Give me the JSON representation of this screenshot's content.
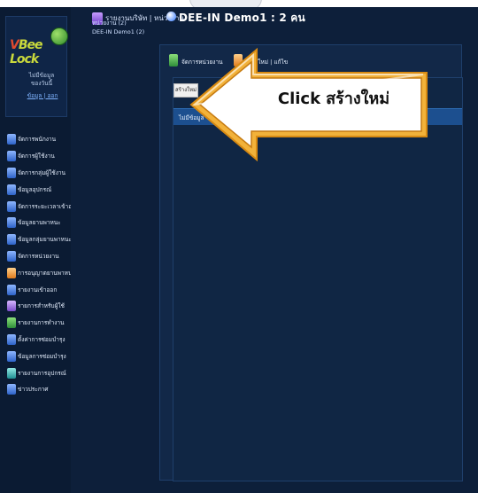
{
  "header": {
    "breadcrumb": "รายงานบริษัท | หน่วยงาน",
    "title": "DEE-IN Demo1 : 2 คน",
    "sub_label": "หน่วยงาน (2)",
    "group_label": "DEE-IN Demo1 (2)"
  },
  "sidebar": {
    "logo_prefix": "V",
    "logo_text": "Bee Lock",
    "user_info_line1": "ไม่มีข้อมูล",
    "user_info_line2": "ของวันนี้",
    "user_links": "ข้อมูล | ออก",
    "items": [
      {
        "label": "จัดการพนักงาน",
        "color": "blue"
      },
      {
        "label": "จัดการผู้ใช้งาน",
        "color": "blue"
      },
      {
        "label": "จัดการกลุ่มผู้ใช้งาน",
        "color": "blue"
      },
      {
        "label": "ข้อมูลอุปกรณ์",
        "color": "blue"
      },
      {
        "label": "จัดการระยะเวลาเข้าออก",
        "color": "blue"
      },
      {
        "label": "ข้อมูลยานพาหนะ",
        "color": "blue"
      },
      {
        "label": "ข้อมูลกลุ่มยานพาหนะ",
        "color": "blue"
      },
      {
        "label": "จัดการหน่วยงาน",
        "color": "blue"
      },
      {
        "label": "การอนุญาตยานพาหนะ",
        "color": "orange"
      },
      {
        "label": "รายงานเข้าออก",
        "color": "blue"
      },
      {
        "label": "รายการสำหรับผู้ใช้",
        "color": "purple"
      },
      {
        "label": "รายงานการทำงาน",
        "color": "green"
      },
      {
        "label": "ตั้งค่าการซ่อมบำรุง",
        "color": "blue"
      },
      {
        "label": "ข้อมูลการซ่อมบำรุง",
        "color": "blue"
      },
      {
        "label": "รายงานการอุปกรณ์",
        "color": "teal"
      },
      {
        "label": "ข่าวประกาศ",
        "color": "blue"
      }
    ]
  },
  "main": {
    "tab_a": "จัดการหน่วยงาน",
    "tab_b": "สร้างใหม่ | แก้ไข",
    "create_button": "สร้างใหม่",
    "table_header": "ไม่มีข้อมูล"
  },
  "callout": {
    "click": "Click",
    "action": "สร้างใหม่"
  }
}
